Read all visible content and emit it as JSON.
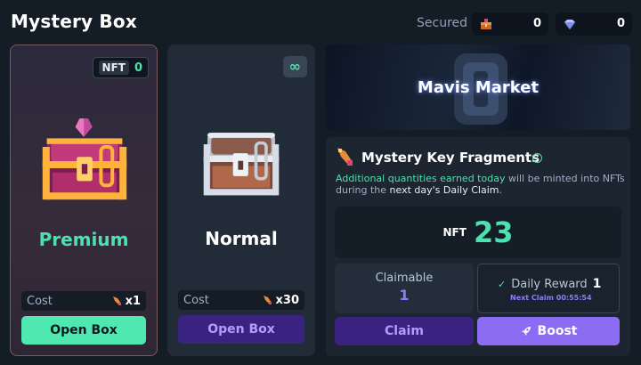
{
  "header": {
    "title": "Mystery Box",
    "secured_label": "Secured",
    "currency1": {
      "icon": "chest-coin-icon",
      "value": "0"
    },
    "currency2": {
      "icon": "diamond-icon",
      "value": "0"
    }
  },
  "premium": {
    "nft_label": "NFT",
    "nft_count": "0",
    "name": "Premium",
    "cost_label": "Cost",
    "cost_amount": "x1",
    "button": "Open Box",
    "name_color": "#4fe0b0"
  },
  "normal": {
    "badge_icon": "infinity-icon",
    "name": "Normal",
    "cost_label": "Cost",
    "cost_amount": "x30",
    "button": "Open Box"
  },
  "banner": {
    "text": "Mavis Market"
  },
  "fragments": {
    "title": "Mystery Key Fragments",
    "desc_part1": "Additional quantities earned today",
    "desc_part2": " will be minted into NFTs during the ",
    "desc_part3": "next day's Daily Claim",
    "desc_part4": ".",
    "nft_label": "NFT",
    "nft_value": "23",
    "claimable_label": "Claimable",
    "claimable_value": "1",
    "daily_label": "Daily Reward",
    "daily_value": "1",
    "next_claim": "Next Claim 00:55:54",
    "claim_button": "Claim",
    "boost_button": "Boost"
  },
  "colors": {
    "accent_green": "#4fe0b0",
    "accent_purple": "#8b6cf3"
  }
}
